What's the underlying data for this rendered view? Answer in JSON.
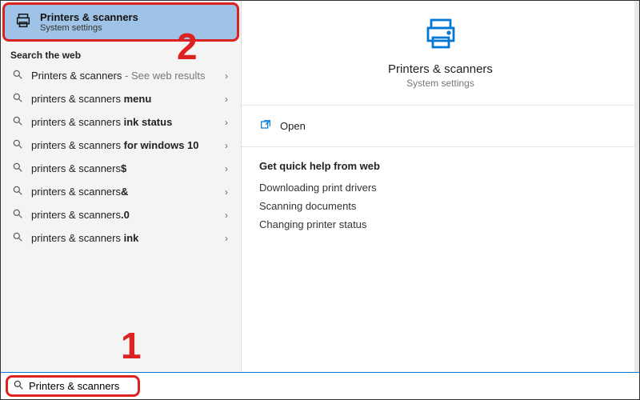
{
  "top_result": {
    "title": "Printers & scanners",
    "subtitle": "System settings"
  },
  "web_section_label": "Search the web",
  "suggestions": [
    {
      "prefix": "Printers & scanners",
      "bold": "",
      "suffix": " - See web results",
      "gray_suffix": true
    },
    {
      "prefix": "printers & scanners ",
      "bold": "menu",
      "suffix": ""
    },
    {
      "prefix": "printers & scanners ",
      "bold": "ink status",
      "suffix": ""
    },
    {
      "prefix": "printers & scanners ",
      "bold": "for windows 10",
      "suffix": ""
    },
    {
      "prefix": "printers & scanners",
      "bold": "$",
      "suffix": ""
    },
    {
      "prefix": "printers & scanners",
      "bold": "&",
      "suffix": ""
    },
    {
      "prefix": "printers & scanners",
      "bold": ".0",
      "suffix": ""
    },
    {
      "prefix": "printers & scanners ",
      "bold": "ink",
      "suffix": ""
    }
  ],
  "preview": {
    "title": "Printers & scanners",
    "subtitle": "System settings",
    "open_label": "Open",
    "help_title": "Get quick help from web",
    "help_links": [
      "Downloading print drivers",
      "Scanning documents",
      "Changing printer status"
    ]
  },
  "search": {
    "value": "Printers & scanners"
  },
  "annotations": {
    "step1": "1",
    "step2": "2"
  },
  "colors": {
    "accent": "#0078d4",
    "highlight_bg": "#9ec3e6",
    "annotation": "#d22222"
  }
}
